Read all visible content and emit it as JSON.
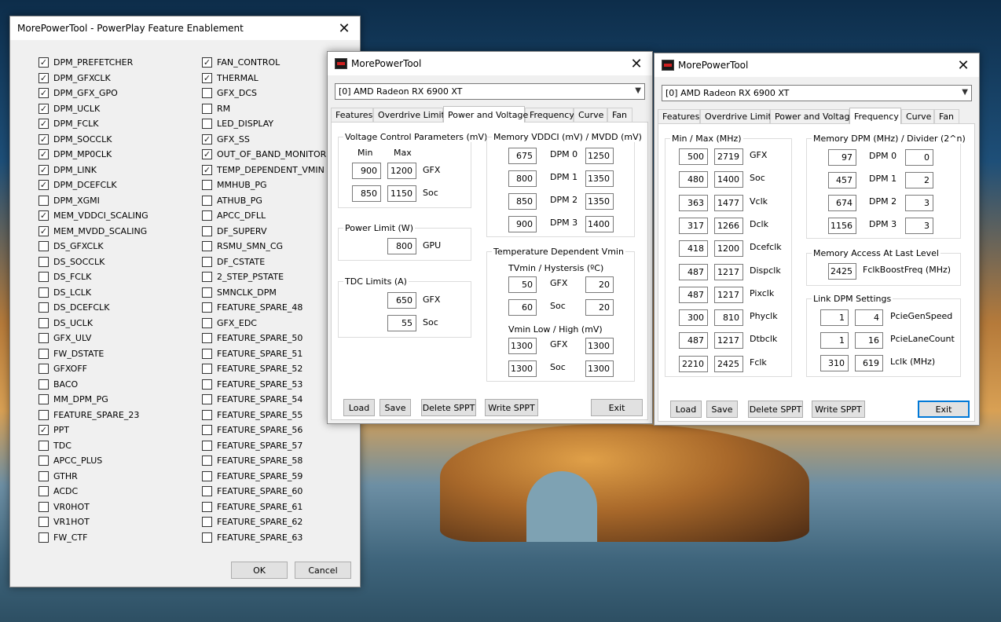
{
  "desktop": {
    "colors": {
      "sky": "#1e4f78",
      "sand": "#d8a054",
      "sea": "#3f657c"
    }
  },
  "feat": {
    "title": "MorePowerTool - PowerPlay Feature Enablement",
    "left": [
      {
        "label": "DPM_PREFETCHER",
        "checked": true
      },
      {
        "label": "DPM_GFXCLK",
        "checked": true
      },
      {
        "label": "DPM_GFX_GPO",
        "checked": true
      },
      {
        "label": "DPM_UCLK",
        "checked": true
      },
      {
        "label": "DPM_FCLK",
        "checked": true
      },
      {
        "label": "DPM_SOCCLK",
        "checked": true
      },
      {
        "label": "DPM_MP0CLK",
        "checked": true
      },
      {
        "label": "DPM_LINK",
        "checked": true
      },
      {
        "label": "DPM_DCEFCLK",
        "checked": true
      },
      {
        "label": "DPM_XGMI",
        "checked": false
      },
      {
        "label": "MEM_VDDCI_SCALING",
        "checked": true
      },
      {
        "label": "MEM_MVDD_SCALING",
        "checked": true
      },
      {
        "label": "DS_GFXCLK",
        "checked": false
      },
      {
        "label": "DS_SOCCLK",
        "checked": false
      },
      {
        "label": "DS_FCLK",
        "checked": false
      },
      {
        "label": "DS_LCLK",
        "checked": false
      },
      {
        "label": "DS_DCEFCLK",
        "checked": false
      },
      {
        "label": "DS_UCLK",
        "checked": false
      },
      {
        "label": "GFX_ULV",
        "checked": false
      },
      {
        "label": "FW_DSTATE",
        "checked": false
      },
      {
        "label": "GFXOFF",
        "checked": false
      },
      {
        "label": "BACO",
        "checked": false
      },
      {
        "label": "MM_DPM_PG",
        "checked": false
      },
      {
        "label": "FEATURE_SPARE_23",
        "checked": false
      },
      {
        "label": "PPT",
        "checked": true
      },
      {
        "label": "TDC",
        "checked": false
      },
      {
        "label": "APCC_PLUS",
        "checked": false
      },
      {
        "label": "GTHR",
        "checked": false
      },
      {
        "label": "ACDC",
        "checked": false
      },
      {
        "label": "VR0HOT",
        "checked": false
      },
      {
        "label": "VR1HOT",
        "checked": false
      },
      {
        "label": "FW_CTF",
        "checked": false
      }
    ],
    "right": [
      {
        "label": "FAN_CONTROL",
        "checked": true
      },
      {
        "label": "THERMAL",
        "checked": true
      },
      {
        "label": "GFX_DCS",
        "checked": false
      },
      {
        "label": "RM",
        "checked": false
      },
      {
        "label": "LED_DISPLAY",
        "checked": false
      },
      {
        "label": "GFX_SS",
        "checked": true
      },
      {
        "label": "OUT_OF_BAND_MONITOR",
        "checked": true
      },
      {
        "label": "TEMP_DEPENDENT_VMIN",
        "checked": true
      },
      {
        "label": "MMHUB_PG",
        "checked": false
      },
      {
        "label": "ATHUB_PG",
        "checked": false
      },
      {
        "label": "APCC_DFLL",
        "checked": false
      },
      {
        "label": "DF_SUPERV",
        "checked": false
      },
      {
        "label": "RSMU_SMN_CG",
        "checked": false
      },
      {
        "label": "DF_CSTATE",
        "checked": false
      },
      {
        "label": "2_STEP_PSTATE",
        "checked": false
      },
      {
        "label": "SMNCLK_DPM",
        "checked": false
      },
      {
        "label": "FEATURE_SPARE_48",
        "checked": false
      },
      {
        "label": "GFX_EDC",
        "checked": false
      },
      {
        "label": "FEATURE_SPARE_50",
        "checked": false
      },
      {
        "label": "FEATURE_SPARE_51",
        "checked": false
      },
      {
        "label": "FEATURE_SPARE_52",
        "checked": false
      },
      {
        "label": "FEATURE_SPARE_53",
        "checked": false
      },
      {
        "label": "FEATURE_SPARE_54",
        "checked": false
      },
      {
        "label": "FEATURE_SPARE_55",
        "checked": false
      },
      {
        "label": "FEATURE_SPARE_56",
        "checked": false
      },
      {
        "label": "FEATURE_SPARE_57",
        "checked": false
      },
      {
        "label": "FEATURE_SPARE_58",
        "checked": false
      },
      {
        "label": "FEATURE_SPARE_59",
        "checked": false
      },
      {
        "label": "FEATURE_SPARE_60",
        "checked": false
      },
      {
        "label": "FEATURE_SPARE_61",
        "checked": false
      },
      {
        "label": "FEATURE_SPARE_62",
        "checked": false
      },
      {
        "label": "FEATURE_SPARE_63",
        "checked": false
      }
    ],
    "ok": "OK",
    "cancel": "Cancel"
  },
  "pv": {
    "title": "MorePowerTool",
    "gpu": "[0] AMD Radeon RX 6900 XT",
    "tabs": [
      "Features",
      "Overdrive Limits",
      "Power and Voltage",
      "Frequency",
      "Curve",
      "Fan"
    ],
    "vc": {
      "label": "Voltage Control Parameters (mV)",
      "min": "Min",
      "max": "Max",
      "gfx": "GFX",
      "soc": "Soc",
      "gfx_min": "900",
      "gfx_max": "1200",
      "soc_min": "850",
      "soc_max": "1150"
    },
    "pl": {
      "label": "Power Limit (W)",
      "val": "800",
      "gpu": "GPU"
    },
    "tdc": {
      "label": "TDC Limits (A)",
      "gfx": "GFX",
      "soc": "Soc",
      "gfx_val": "650",
      "soc_val": "55"
    },
    "mem": {
      "label": "Memory VDDCI (mV) / MVDD (mV)",
      "rows": [
        {
          "a": "675",
          "dpm": "DPM 0",
          "b": "1250"
        },
        {
          "a": "800",
          "dpm": "DPM 1",
          "b": "1350"
        },
        {
          "a": "850",
          "dpm": "DPM 2",
          "b": "1350"
        },
        {
          "a": "900",
          "dpm": "DPM 3",
          "b": "1400"
        }
      ]
    },
    "tdv": {
      "label": "Temperature Dependent Vmin",
      "sub1": "TVmin / Hystersis (ºC)",
      "sub2": "Vmin Low / High (mV)",
      "gfx": "GFX",
      "soc": "Soc",
      "t_gfx_a": "50",
      "t_gfx_b": "20",
      "t_soc_a": "60",
      "t_soc_b": "20",
      "v_gfx_a": "1300",
      "v_gfx_b": "1300",
      "v_soc_a": "1300",
      "v_soc_b": "1300"
    },
    "buttons": {
      "load": "Load",
      "save": "Save",
      "del": "Delete SPPT",
      "write": "Write SPPT",
      "exit": "Exit"
    }
  },
  "fr": {
    "title": "MorePowerTool",
    "gpu": "[0] AMD Radeon RX 6900 XT",
    "tabs": [
      "Features",
      "Overdrive Limits",
      "Power and Voltage",
      "Frequency",
      "Curve",
      "Fan"
    ],
    "mm": {
      "label": "Min / Max (MHz)",
      "rows": [
        {
          "min": "500",
          "max": "2719",
          "name": "GFX"
        },
        {
          "min": "480",
          "max": "1400",
          "name": "Soc"
        },
        {
          "min": "363",
          "max": "1477",
          "name": "Vclk"
        },
        {
          "min": "317",
          "max": "1266",
          "name": "Dclk"
        },
        {
          "min": "418",
          "max": "1200",
          "name": "Dcefclk"
        },
        {
          "min": "487",
          "max": "1217",
          "name": "Dispclk"
        },
        {
          "min": "487",
          "max": "1217",
          "name": "Pixclk"
        },
        {
          "min": "300",
          "max": "810",
          "name": "Phyclk"
        },
        {
          "min": "487",
          "max": "1217",
          "name": "Dtbclk"
        },
        {
          "min": "2210",
          "max": "2425",
          "name": "Fclk"
        }
      ]
    },
    "mdpm": {
      "label": "Memory DPM (MHz) / Divider (2^n)",
      "rows": [
        {
          "a": "97",
          "dpm": "DPM 0",
          "b": "0"
        },
        {
          "a": "457",
          "dpm": "DPM 1",
          "b": "2"
        },
        {
          "a": "674",
          "dpm": "DPM 2",
          "b": "3"
        },
        {
          "a": "1156",
          "dpm": "DPM 3",
          "b": "3"
        }
      ]
    },
    "mal": {
      "label": "Memory Access At Last Level",
      "val": "2425",
      "name": "FclkBoostFreq (MHz)"
    },
    "link": {
      "label": "Link DPM Settings",
      "rows": [
        {
          "a": "1",
          "b": "4",
          "name": "PcieGenSpeed"
        },
        {
          "a": "1",
          "b": "16",
          "name": "PcieLaneCount"
        },
        {
          "a": "310",
          "b": "619",
          "name": "Lclk (MHz)"
        }
      ]
    },
    "buttons": {
      "load": "Load",
      "save": "Save",
      "del": "Delete SPPT",
      "write": "Write SPPT",
      "exit": "Exit"
    }
  }
}
